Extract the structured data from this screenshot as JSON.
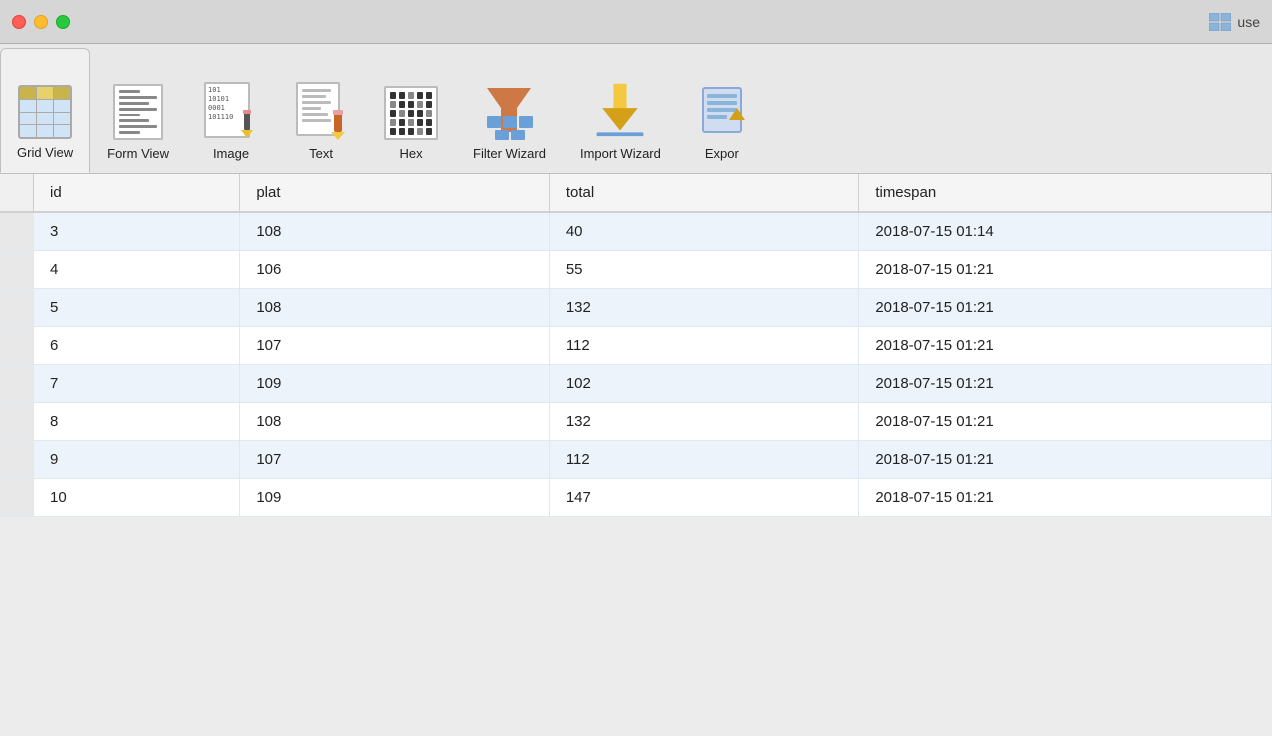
{
  "titlebar": {
    "app_name": "use",
    "grid_icon": "grid-icon"
  },
  "toolbar": {
    "items": [
      {
        "id": "grid-view",
        "label": "Grid View",
        "active": true
      },
      {
        "id": "form-view",
        "label": "Form View",
        "active": false
      },
      {
        "id": "image",
        "label": "Image",
        "active": false
      },
      {
        "id": "text",
        "label": "Text",
        "active": false
      },
      {
        "id": "hex",
        "label": "Hex",
        "active": false
      },
      {
        "id": "filter-wizard",
        "label": "Filter Wizard",
        "active": false
      },
      {
        "id": "import-wizard",
        "label": "Import Wizard",
        "active": false
      },
      {
        "id": "export",
        "label": "Expor",
        "active": false
      }
    ]
  },
  "table": {
    "columns": [
      "id",
      "plat",
      "total",
      "timespan"
    ],
    "rows": [
      {
        "id": "3",
        "plat": "108",
        "total": "40",
        "timespan": "2018-07-15 01:14"
      },
      {
        "id": "4",
        "plat": "106",
        "total": "55",
        "timespan": "2018-07-15 01:21"
      },
      {
        "id": "5",
        "plat": "108",
        "total": "132",
        "timespan": "2018-07-15 01:21"
      },
      {
        "id": "6",
        "plat": "107",
        "total": "112",
        "timespan": "2018-07-15 01:21"
      },
      {
        "id": "7",
        "plat": "109",
        "total": "102",
        "timespan": "2018-07-15 01:21"
      },
      {
        "id": "8",
        "plat": "108",
        "total": "132",
        "timespan": "2018-07-15 01:21"
      },
      {
        "id": "9",
        "plat": "107",
        "total": "112",
        "timespan": "2018-07-15 01:21"
      },
      {
        "id": "10",
        "plat": "109",
        "total": "147",
        "timespan": "2018-07-15 01:21"
      }
    ]
  }
}
